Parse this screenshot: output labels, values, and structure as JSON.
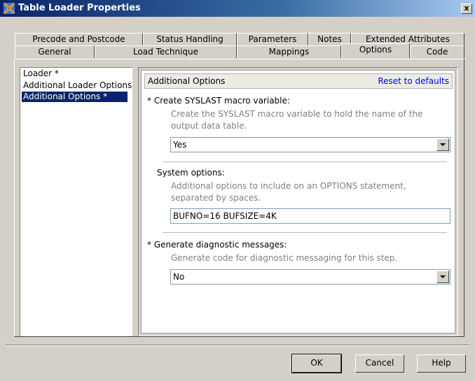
{
  "window": {
    "title": "Table Loader Properties",
    "close_label": "x"
  },
  "tabs_back": [
    {
      "label": "Precode and Postcode"
    },
    {
      "label": "Status Handling"
    },
    {
      "label": "Parameters"
    },
    {
      "label": "Notes"
    },
    {
      "label": "Extended Attributes"
    }
  ],
  "tabs_front": [
    {
      "label": "General"
    },
    {
      "label": "Load Technique"
    },
    {
      "label": "Mappings"
    },
    {
      "label": "Options",
      "active": true
    },
    {
      "label": "Code"
    }
  ],
  "left_list": [
    {
      "label": "Loader *"
    },
    {
      "label": "Additional Loader Options"
    },
    {
      "label": "Additional Options *",
      "selected": true
    }
  ],
  "section": {
    "title": "Additional Options",
    "reset_label": "Reset to defaults"
  },
  "options": {
    "syslast": {
      "label": "* Create SYSLAST macro variable:",
      "description": "Create the SYSLAST macro variable to hold the name of the output data table.",
      "value": "Yes"
    },
    "system": {
      "label": "System options:",
      "description": "Additional options to include on an OPTIONS statement, separated by spaces.",
      "value": "BUFNO=16 BUFSIZE=4K"
    },
    "diagnostic": {
      "label": "* Generate diagnostic messages:",
      "description": "Generate code for diagnostic messaging for this step.",
      "value": "No"
    }
  },
  "buttons": {
    "ok": "OK",
    "cancel": "Cancel",
    "help": "Help"
  },
  "colors": {
    "titlebar": "#0a246a",
    "selection": "#0a246a",
    "link": "#0000ee",
    "face": "#d4d0c8"
  }
}
